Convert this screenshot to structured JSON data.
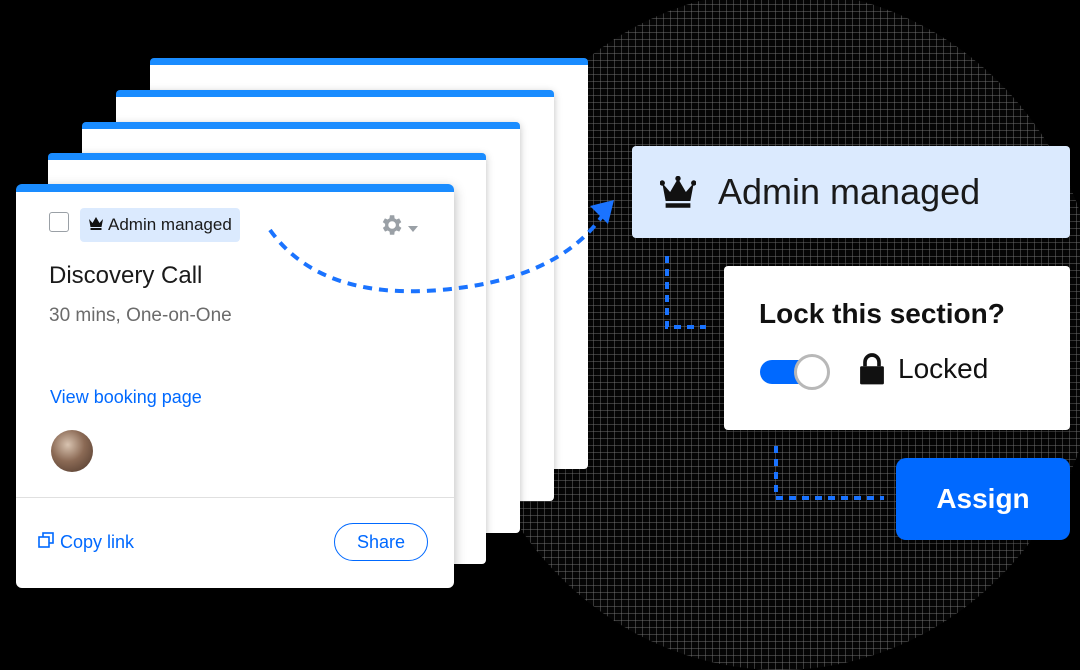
{
  "card": {
    "badge_label": "Admin managed",
    "title": "Discovery Call",
    "subtitle": "30 mins, One-on-One",
    "view_link": "View booking page",
    "copy_link": "Copy link",
    "share_label": "Share"
  },
  "callout": {
    "admin_label": "Admin managed"
  },
  "lock_panel": {
    "question": "Lock this section?",
    "state_label": "Locked",
    "toggle_on": true
  },
  "assign_label": "Assign",
  "colors": {
    "accent": "#0069ff",
    "card_top": "#1a8cff",
    "badge_bg": "#dbeafe"
  }
}
